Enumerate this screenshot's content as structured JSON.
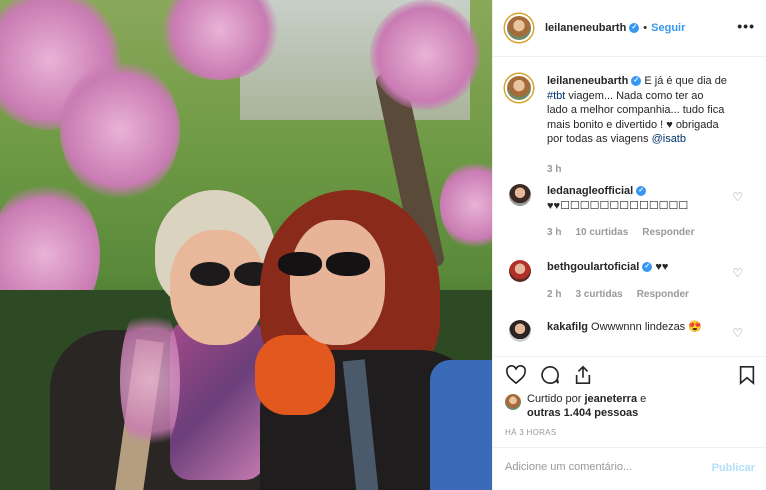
{
  "post": {
    "author": "leilaneneubarth",
    "follow_label": "Seguir",
    "separator": "•",
    "more_label": "•••"
  },
  "caption": {
    "username": "leilaneneubarth",
    "text_before": "E já é que dia de",
    "hashtag": "#tbt",
    "text_after": "viagem... Nada como ter ao lado a melhor companhia... tudo fica mais bonito e divertido ! ♥ obrigada por todas as viagens",
    "mention": "@isatb",
    "time": "3 h"
  },
  "comments": [
    {
      "username": "ledanagleofficial",
      "text": "♥♥☐☐☐☐☐☐☐☐☐☐☐☐☐",
      "time": "3 h",
      "likes": "10 curtidas",
      "reply": "Responder"
    },
    {
      "username": "bethgoulartoficial",
      "text": "♥♥",
      "time": "2 h",
      "likes": "3 curtidas",
      "reply": "Responder"
    },
    {
      "username": "kakafilg",
      "text": "Owwwnnn lindezas 😍",
      "time": "",
      "likes": "",
      "reply": ""
    }
  ],
  "likes": {
    "prefix": "Curtido por",
    "user": "jeaneterra",
    "connector": "e",
    "others": "outras 1.404 pessoas"
  },
  "timestamp": "HÁ 3 HORAS",
  "add_comment": {
    "placeholder": "Adicione um comentário...",
    "publish_label": "Publicar"
  },
  "icons": [
    "verified-badge-icon",
    "heart-icon",
    "comment-icon",
    "share-icon",
    "bookmark-icon",
    "more-options-icon"
  ],
  "colors": {
    "link": "#3897f0",
    "hashtag": "#003569",
    "muted": "#999999"
  }
}
